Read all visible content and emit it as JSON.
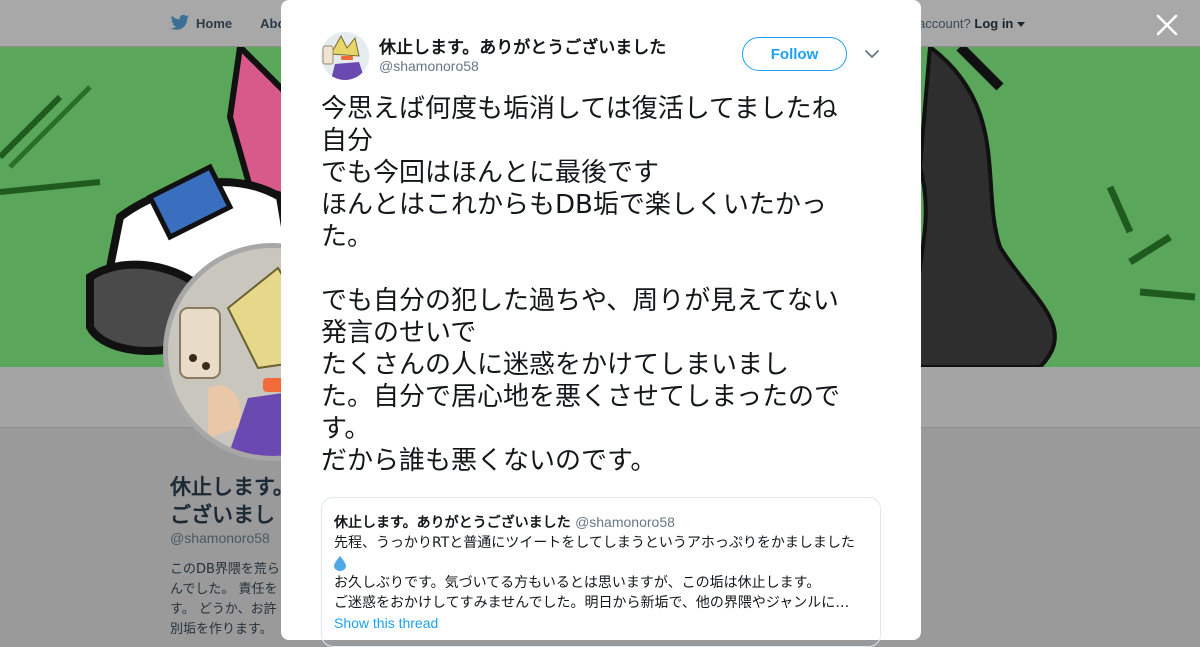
{
  "nav": {
    "home_label": "Home",
    "about_label": "Abo",
    "account_prompt": "account?",
    "login_label": "Log in"
  },
  "profile": {
    "name_line1": "休止します。あり",
    "name_line2": "ございまし",
    "handle": "@shamonoro58",
    "bio_lines": [
      "このDB界隈を荒ら",
      "んでした。 責任を",
      "す。 どうか、お許",
      "別垢を作ります。"
    ]
  },
  "tweet": {
    "author_name": "休止します。ありがとうございました",
    "author_handle": "@shamonoro58",
    "follow_label": "Follow",
    "text_lines": [
      "今思えば何度も垢消しては復活してましたね",
      "自分",
      "でも今回はほんとに最後です",
      "ほんとはこれからもDB垢で楽しくいたかっ",
      "た。",
      "",
      "でも自分の犯した過ちや、周りが見えてない",
      "発言のせいで",
      "たくさんの人に迷惑をかけてしまいまし",
      "た。自分で居心地を悪くさせてしまったので",
      "す。",
      "だから誰も悪くないのです。"
    ]
  },
  "quoted": {
    "author_name": "休止します。ありがとうございました",
    "author_handle": "@shamonoro58",
    "line1": "先程、うっかりRTと普通にツイートをしてしまうというアホっぷりをかましました",
    "line3": "お久しぶりです。気づいてる方もいるとは思いますが、この垢は休止します。",
    "line4": "ご迷惑をおかけしてすみませんでした。明日から新垢で、他の界隈やジャンルに…",
    "show_thread_label": "Show this thread",
    "emoji_icon": "droplet-icon"
  },
  "colors": {
    "accent": "#1da1f2",
    "overlay_bg": "#9a9a9a",
    "banner_green": "#5aa65a"
  }
}
